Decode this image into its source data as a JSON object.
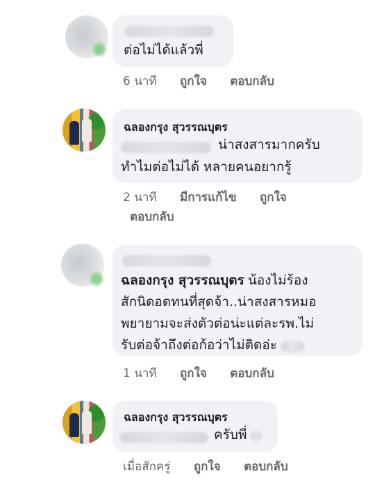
{
  "comments": [
    {
      "author": "",
      "text_lines": [
        "ต่อไม่ได้แล้วพี่"
      ],
      "time": "6 นาที",
      "like": "ถูกใจ",
      "reply": "ตอบกลับ"
    },
    {
      "author": "ฉลองกรุง สุวรรณบุตร",
      "text_lines": [
        "น่าสงสารมากครับ",
        "ทำไมต่อไม่ได้ หลายคนอยากรู้"
      ],
      "time": "2 นาที",
      "edited": "มีการแก้ไข",
      "like": "ถูกใจ",
      "reply": "ตอบกลับ"
    },
    {
      "author": "",
      "text_lines": [
        "ฉลองกรุง สุวรรณบุตร",
        "น้องไม่ร้อง",
        "สักนิดอดทนที่สุดจ้า..น่าสงสารหมอ",
        "พยายามจะส่งตัวต่อน่ะแต่ละรพ.ไม่",
        "รับต่อจ้าถึงต่อก้อว่าไม่ติดอ่ะ"
      ],
      "time": "1 นาที",
      "like": "ถูกใจ",
      "reply": "ตอบกลับ"
    },
    {
      "author": "ฉลองกรุง สุวรรณบุตร",
      "text_lines": [
        "ครับพี่"
      ],
      "time": "เมื่อสักครู่",
      "like": "ถูกใจ",
      "reply": "ตอบกลับ"
    }
  ]
}
